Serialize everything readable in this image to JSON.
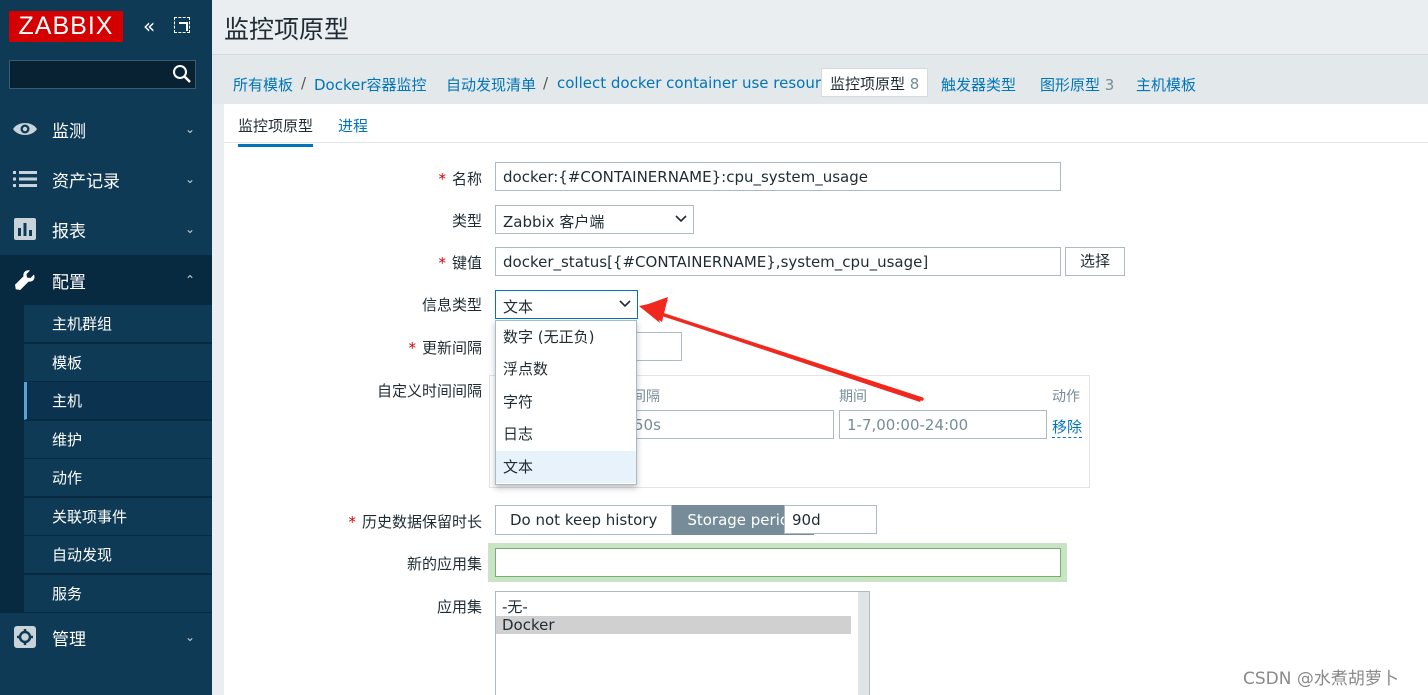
{
  "sidebar": {
    "logo": "ZABBIX",
    "search_placeholder": "",
    "menu": [
      {
        "label": "监测",
        "icon": "eye-icon"
      },
      {
        "label": "资产记录",
        "icon": "list-icon"
      },
      {
        "label": "报表",
        "icon": "bar-chart-icon"
      },
      {
        "label": "配置",
        "icon": "wrench-icon"
      },
      {
        "label": "管理",
        "icon": "gear-icon"
      }
    ],
    "submenu": [
      "主机群组",
      "模板",
      "主机",
      "维护",
      "动作",
      "关联项事件",
      "自动发现",
      "服务"
    ]
  },
  "page": {
    "title": "监控项原型"
  },
  "breadcrumbs": {
    "all_templates": "所有模板",
    "template": "Docker容器监控",
    "discovery_list": "自动发现清单",
    "discovery_rule": "collect docker container use resource",
    "item_prototypes": "监控项原型",
    "item_prototypes_count": "8",
    "trigger_types": "触发器类型",
    "graph_prototypes": "图形原型",
    "graph_prototypes_count": "3",
    "host_templates": "主机模板",
    "separator": "/"
  },
  "subtabs": {
    "item_prototype": "监控项原型",
    "process": "进程"
  },
  "form": {
    "name_label": "名称",
    "name_value": "docker:{#CONTAINERNAME}:cpu_system_usage",
    "type_label": "类型",
    "type_value": "Zabbix 客户端",
    "key_label": "键值",
    "key_value": "docker_status[{#CONTAINERNAME},system_cpu_usage]",
    "select_button": "选择",
    "info_type_label": "信息类型",
    "info_type_value": "文本",
    "info_type_options": [
      "数字 (无正负)",
      "浮点数",
      "字符",
      "日志",
      "文本"
    ],
    "update_interval_label": "更新间隔",
    "custom_interval_label": "自定义时间间隔",
    "interval_head_partial": "间隔",
    "period_head": "期间",
    "action_head": "动作",
    "interval_value_partial": "50s",
    "period_value": "1-7,00:00-24:00",
    "remove_link": "移除",
    "history_label": "历史数据保留时长",
    "history_no_keep": "Do not keep history",
    "history_storage": "Storage period",
    "history_value": "90d",
    "new_app_label": "新的应用集",
    "new_app_value": "",
    "apps_label": "应用集",
    "apps": [
      "-无-",
      "Docker"
    ]
  },
  "watermark": "CSDN @水煮胡萝卜",
  "colors": {
    "sidebar": "#0e3a55",
    "logo": "#d40000",
    "link": "#0275b8",
    "arrow": "#f0281e"
  }
}
